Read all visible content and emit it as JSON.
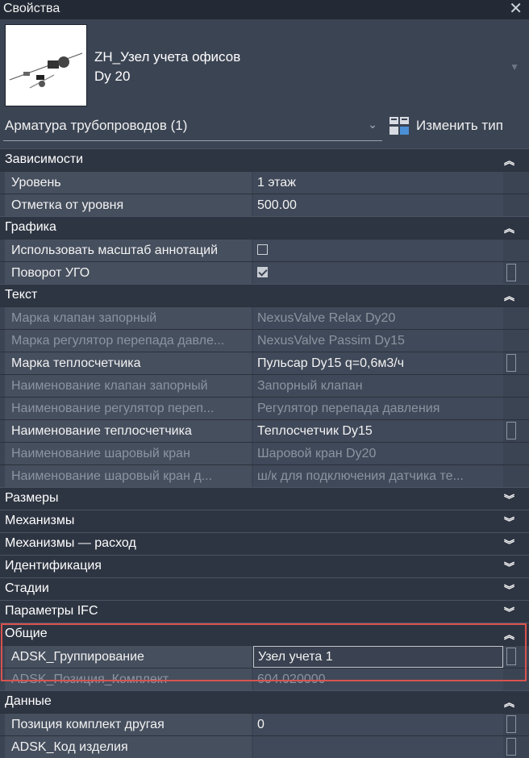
{
  "window": {
    "title": "Свойства"
  },
  "type_selector": {
    "name_line1": "ZH_Узел учета офисов",
    "name_line2": "Dy 20"
  },
  "instance_selector": {
    "label": "Арматура трубопроводов (1)",
    "edit_type_label": "Изменить тип"
  },
  "icons": {
    "close": "close-icon",
    "dropdown": "chevron-down-icon",
    "edit_type": "edit-type-icon",
    "collapse": "double-chevron-up-icon",
    "expand": "double-chevron-down-icon"
  },
  "colors": {
    "highlight": "#d9534f",
    "panel": "#3b4453",
    "header": "#2e3542"
  },
  "sections": {
    "constraints": {
      "title": "Зависимости",
      "rows": [
        {
          "k": "Уровень",
          "v": "1 этаж"
        },
        {
          "k": "Отметка от уровня",
          "v": "500.00"
        }
      ]
    },
    "graphics": {
      "title": "Графика",
      "rows": [
        {
          "k": "Использовать масштаб аннотаций",
          "checked": false
        },
        {
          "k": "Поворот УГО",
          "checked": true
        }
      ]
    },
    "text": {
      "title": "Текст",
      "rows": [
        {
          "k": "Марка клапан запорный",
          "v": "NexusValve Relax Dy20"
        },
        {
          "k": "Марка регулятор перепада давле...",
          "v": "NexusValve Passim Dy15"
        },
        {
          "k": "Марка теплосчетчика",
          "v": "Пульсар Dy15 q=0,6м3/ч"
        },
        {
          "k": "Наименование клапан запорный",
          "v": "Запорный клапан"
        },
        {
          "k": "Наименование регулятор переп...",
          "v": "Регулятор перепада давления"
        },
        {
          "k": "Наименование теплосчетчика",
          "v": "Теплосчетчик Dy15"
        },
        {
          "k": "Наименование шаровый кран",
          "v": "Шаровой кран Dy20"
        },
        {
          "k": "Наименование шаровый кран д...",
          "v": "ш/к для подключения датчика те..."
        }
      ]
    },
    "collapsed": [
      "Размеры",
      "Механизмы",
      "Механизмы — расход",
      "Идентификация",
      "Стадии",
      "Параметры IFC"
    ],
    "general": {
      "title": "Общие",
      "rows": [
        {
          "k": "ADSK_Группирование",
          "v": "Узел учета 1"
        },
        {
          "k": "ADSK_Позиция_Комплект",
          "v": "604.020000"
        }
      ]
    },
    "data": {
      "title": "Данные",
      "rows": [
        {
          "k": "Позиция комплект другая",
          "v": "0"
        },
        {
          "k": "ADSK_Код изделия",
          "v": ""
        }
      ]
    }
  }
}
